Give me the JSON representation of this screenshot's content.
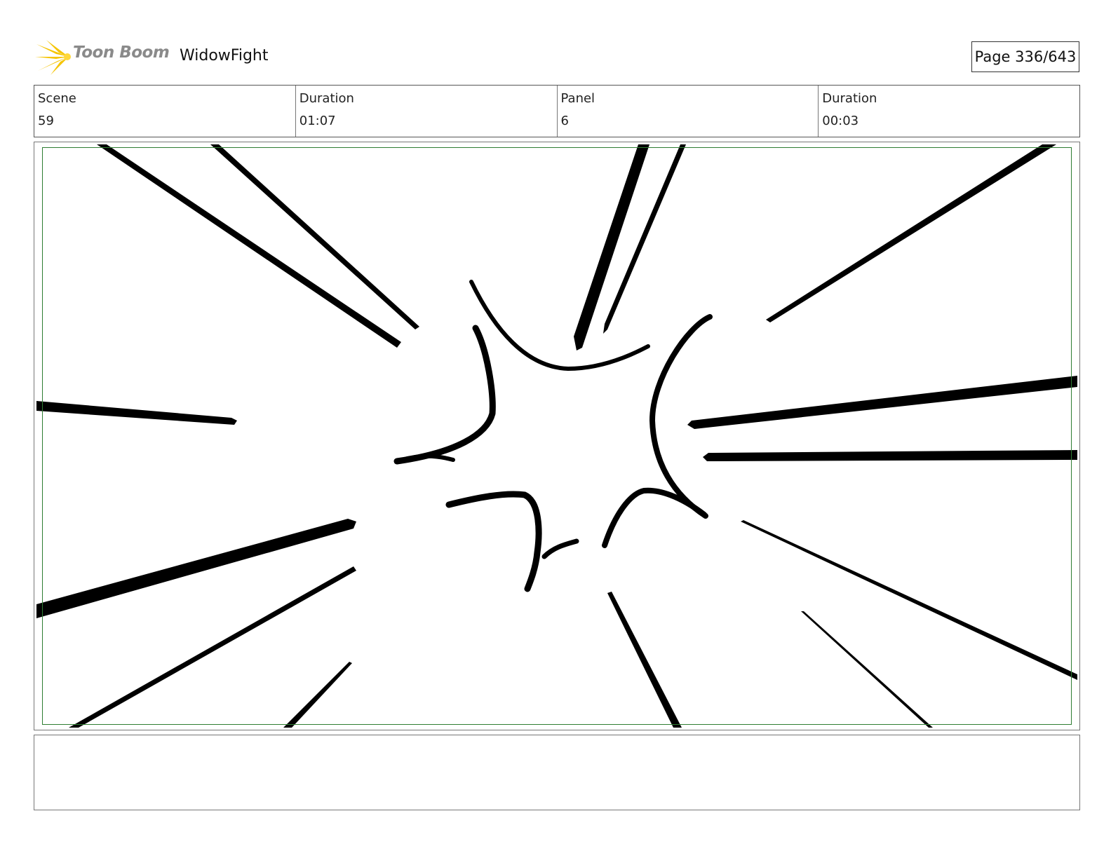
{
  "header": {
    "brand": "Toon Boom",
    "project_title": "WidowFight",
    "page_label": "Page 336/643"
  },
  "info": {
    "scene_label": "Scene",
    "scene_value": "59",
    "scene_duration_label": "Duration",
    "scene_duration_value": "01:07",
    "panel_label": "Panel",
    "panel_value": "6",
    "panel_duration_label": "Duration",
    "panel_duration_value": "00:03"
  },
  "notes": {
    "text": ""
  },
  "colors": {
    "safe_frame": "#2e7d32",
    "logo_star": "#f5c400",
    "ink": "#000000"
  }
}
